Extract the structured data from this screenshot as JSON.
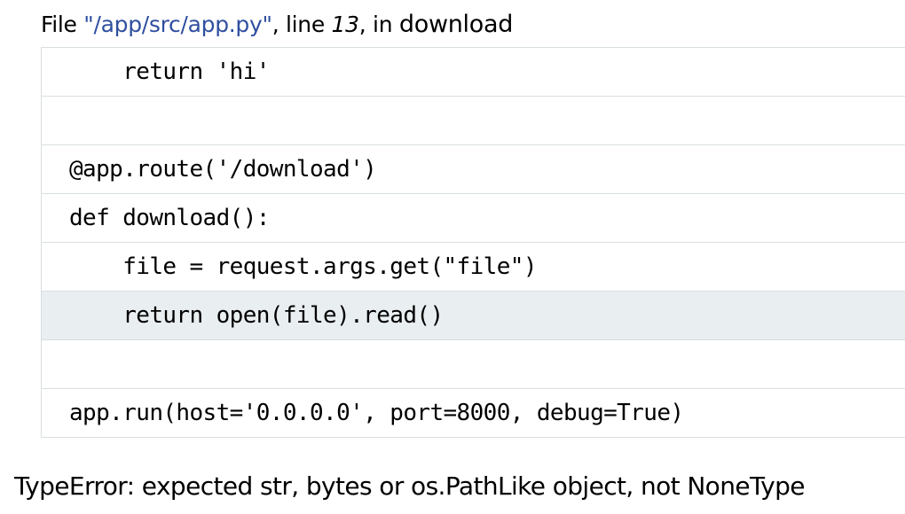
{
  "frame": {
    "prefix": "File ",
    "filename": "\"/app/src/app.py\"",
    "middle": ", line ",
    "lineno": "13",
    "suffix": ", in ",
    "function": "download"
  },
  "source_lines": [
    {
      "code": "    return 'hi'",
      "current": false
    },
    {
      "code": "",
      "current": false
    },
    {
      "code": "@app.route('/download')",
      "current": false
    },
    {
      "code": "def download():",
      "current": false
    },
    {
      "code": "    file = request.args.get(\"file\")",
      "current": false
    },
    {
      "code": "    return open(file).read()",
      "current": true
    },
    {
      "code": "",
      "current": false
    },
    {
      "code": "app.run(host='0.0.0.0', port=8000, debug=True)",
      "current": false
    }
  ],
  "exception": {
    "message": "TypeError: expected str, bytes or os.PathLike object, not NoneType"
  }
}
